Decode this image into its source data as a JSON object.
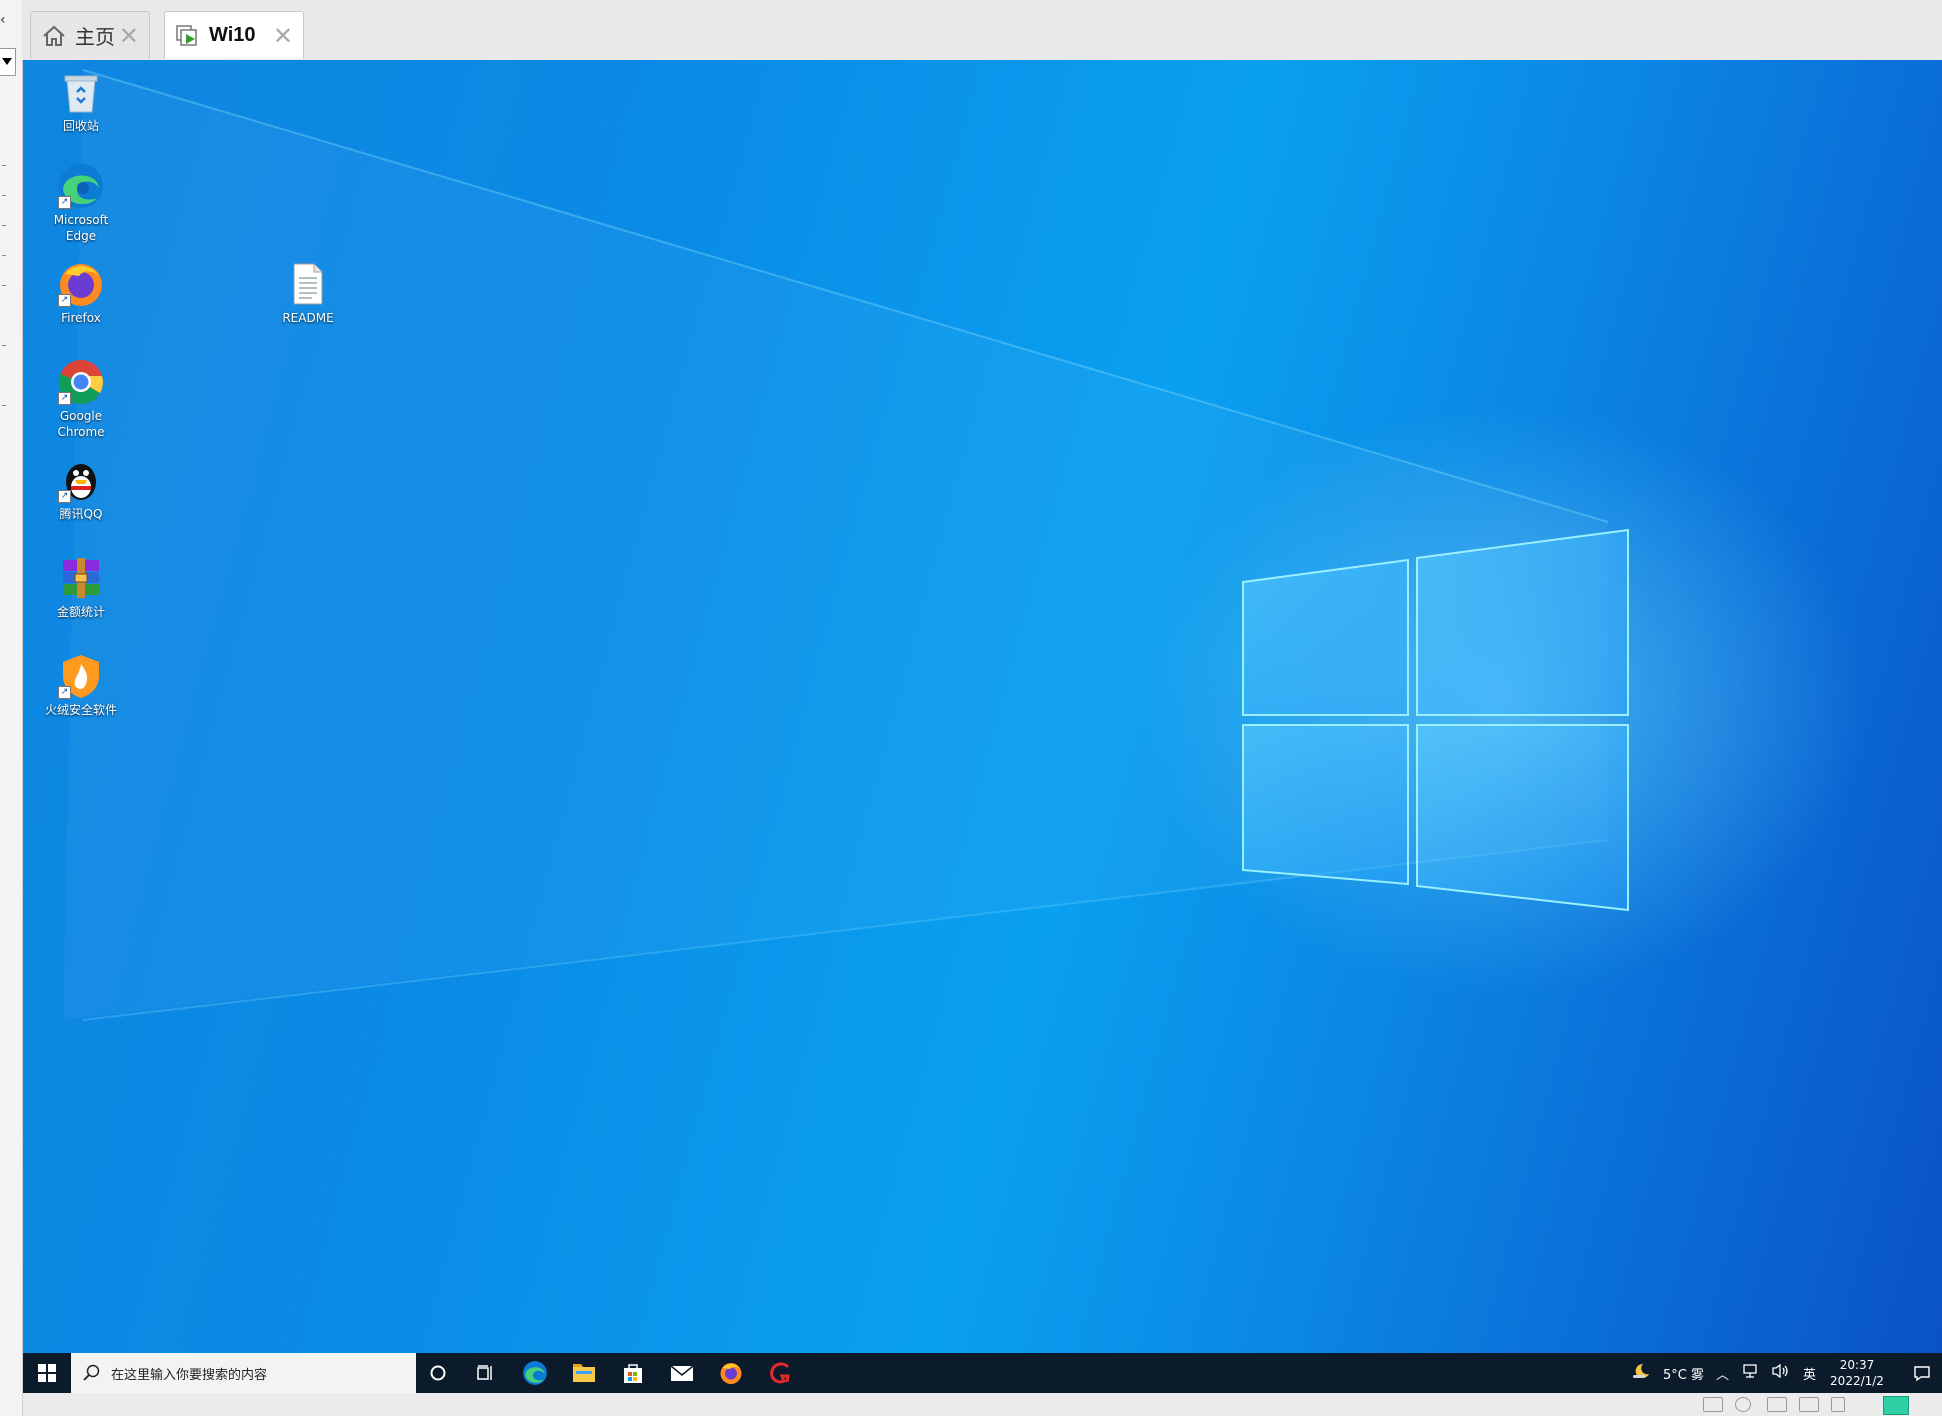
{
  "host": {
    "tabs": [
      {
        "label": "主页",
        "icon": "home-icon"
      },
      {
        "label": "Wi10",
        "icon": "vm-icon"
      }
    ]
  },
  "desktop": {
    "icons": [
      {
        "label": "回收站",
        "icon": "recycle-bin-icon"
      },
      {
        "label": "Microsoft Edge",
        "icon": "edge-icon"
      },
      {
        "label": "Firefox",
        "icon": "firefox-icon"
      },
      {
        "label": "Google Chrome",
        "icon": "chrome-icon"
      },
      {
        "label": "腾讯QQ",
        "icon": "qq-icon"
      },
      {
        "label": "金额统计",
        "icon": "archive-icon"
      },
      {
        "label": "火绒安全软件",
        "icon": "huorong-icon"
      },
      {
        "label": "README",
        "icon": "text-file-icon"
      }
    ]
  },
  "taskbar": {
    "search_placeholder": "在这里输入你要搜索的内容",
    "pinned": [
      "cortana-icon",
      "task-view-icon",
      "edge-icon",
      "file-explorer-icon",
      "store-icon",
      "mail-icon",
      "firefox-icon",
      "wps-icon"
    ],
    "tray": {
      "weather": "5°C 雾",
      "ime": "英",
      "time": "20:37",
      "date": "2022/1/2"
    }
  },
  "colors": {
    "taskbar": "#0c1b2b",
    "desktop_blue": "#0a8be6",
    "accent": "#1aa0f0"
  }
}
